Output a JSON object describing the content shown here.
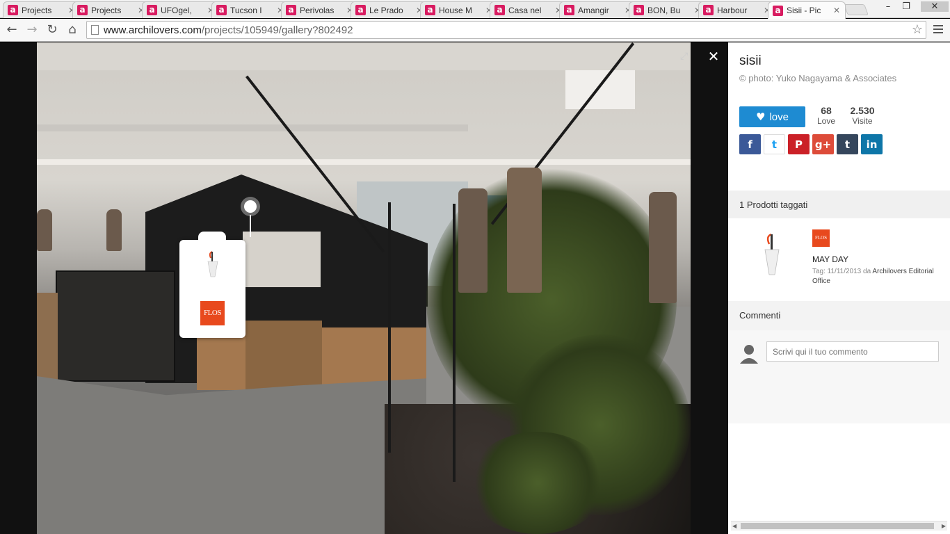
{
  "tabs": [
    {
      "label": "Projects",
      "active": false
    },
    {
      "label": "Projects",
      "active": false
    },
    {
      "label": "UFOgel,",
      "active": false
    },
    {
      "label": "Tucson I",
      "active": false
    },
    {
      "label": "Perivolas",
      "active": false
    },
    {
      "label": "Le Prado",
      "active": false
    },
    {
      "label": "House M",
      "active": false
    },
    {
      "label": "Casa nel",
      "active": false
    },
    {
      "label": "Amangir",
      "active": false
    },
    {
      "label": "BON, Bu",
      "active": false
    },
    {
      "label": "Harbour",
      "active": false
    },
    {
      "label": "Sisii - Pic",
      "active": true
    }
  ],
  "address_bar": {
    "host": "www.archilovers.com",
    "path": "/projects/105949/gallery?802492"
  },
  "photo_tag": {
    "brand": "FLOS"
  },
  "panel": {
    "title": "sisii",
    "credit": "© photo: Yuko Nagayama & Associates",
    "love_label": "love",
    "love_count": "68",
    "love_caption": "Love",
    "visits_count": "2.530",
    "visits_caption": "Visite",
    "share": [
      {
        "icon": "facebook-icon",
        "glyph": "f",
        "color": "#3b5998"
      },
      {
        "icon": "twitter-icon",
        "glyph": "t",
        "color": "#ffffff"
      },
      {
        "icon": "pinterest-icon",
        "glyph": "P",
        "color": "#cb2027"
      },
      {
        "icon": "google-plus-icon",
        "glyph": "g+",
        "color": "#dd4b39"
      },
      {
        "icon": "tumblr-icon",
        "glyph": "t",
        "color": "#35465c"
      },
      {
        "icon": "linkedin-icon",
        "glyph": "in",
        "color": "#0e76a8"
      }
    ],
    "products_header": "1 Prodotti taggati",
    "product": {
      "brand": "FLOS",
      "name": "MAY DAY",
      "tag_prefix": "Tag: 11/11/2013 da ",
      "tagged_by": "Archilovers Editorial Office"
    },
    "comments_header": "Commenti",
    "comment_placeholder": "Scrivi qui il tuo commento"
  },
  "colors": {
    "brand_pink": "#d81b60",
    "love_blue": "#1e8bd2",
    "flos_orange": "#e8491d"
  }
}
